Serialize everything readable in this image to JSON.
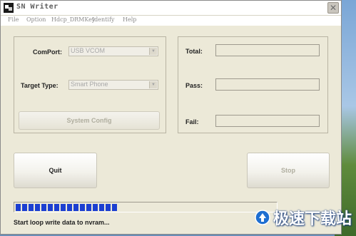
{
  "window": {
    "title": "SN Writer"
  },
  "menu": [
    "File",
    "Option",
    "Hdcp_DRMKey",
    "Identify",
    "Help"
  ],
  "config": {
    "comport_label": "ComPort:",
    "comport_value": "USB VCOM",
    "target_label": "Target Type:",
    "target_value": "Smart Phone",
    "system_config_label": "System Config"
  },
  "stats": {
    "total_label": "Total:",
    "pass_label": "Pass:",
    "fail_label": "Fail:",
    "total_value": "",
    "pass_value": "",
    "fail_value": ""
  },
  "buttons": {
    "quit_label": "Quit",
    "stop_label": "Stop"
  },
  "progress": {
    "blocks_filled": 16,
    "fraction": 0.35
  },
  "status": {
    "text": "Start loop write data to nvram..."
  },
  "watermark": {
    "text": "极速下载站"
  },
  "colors": {
    "progress": "#1c3fd1",
    "window_bg": "#ece9d8"
  },
  "icons": {
    "app": "sn-writer-app-icon",
    "close": "close-icon"
  }
}
